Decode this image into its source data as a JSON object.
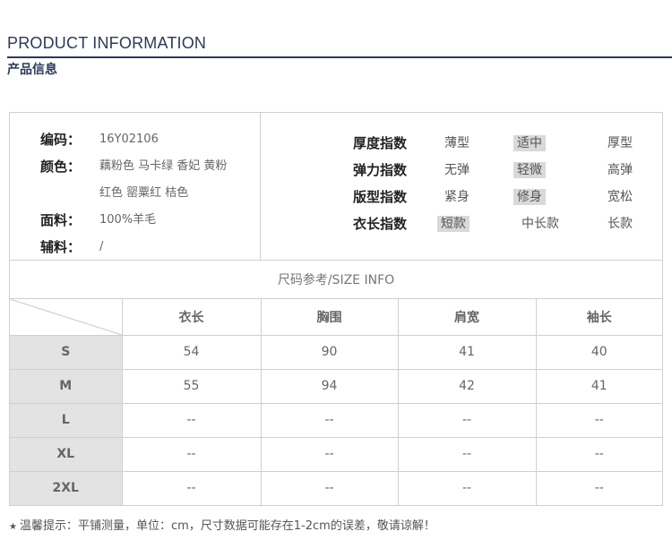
{
  "header": {
    "title_en": "PRODUCT INFORMATION",
    "title_cn": "产品信息"
  },
  "info": [
    {
      "label": "编码：",
      "value": "16Y02106"
    },
    {
      "label": "颜色：",
      "value": "藕粉色  马卡绿  香妃  黄粉"
    },
    {
      "label": "",
      "value": "红色  罂粟红  桔色"
    },
    {
      "label": "面料：",
      "value": "100%羊毛"
    },
    {
      "label": "辅料：",
      "value": "/"
    }
  ],
  "indices": [
    {
      "label": "厚度指数",
      "options": [
        "薄型",
        "适中",
        "厚型"
      ],
      "selected": 1
    },
    {
      "label": "弹力指数",
      "options": [
        "无弹",
        "轻微",
        "高弹"
      ],
      "selected": 1
    },
    {
      "label": "版型指数",
      "options": [
        "紧身",
        "修身",
        "宽松"
      ],
      "selected": 1
    },
    {
      "label": "衣长指数",
      "options": [
        "短款",
        "中长款",
        "长款"
      ],
      "selected": 0
    }
  ],
  "size_info": {
    "title": "尺码参考/SIZE INFO",
    "columns": [
      "衣长",
      "胸围",
      "肩宽",
      "袖长"
    ],
    "rows": [
      {
        "size": "S",
        "values": [
          "54",
          "90",
          "41",
          "40"
        ]
      },
      {
        "size": "M",
        "values": [
          "55",
          "94",
          "42",
          "41"
        ]
      },
      {
        "size": "L",
        "values": [
          "--",
          "--",
          "--",
          "--"
        ]
      },
      {
        "size": "XL",
        "values": [
          "--",
          "--",
          "--",
          "--"
        ]
      },
      {
        "size": "2XL",
        "values": [
          "--",
          "--",
          "--",
          "--"
        ]
      }
    ]
  },
  "note": {
    "icon": "star-icon",
    "label": "温馨提示：",
    "text": "平铺测量，单位：cm，尺寸数据可能存在1-2cm的误差，敬请谅解！"
  }
}
